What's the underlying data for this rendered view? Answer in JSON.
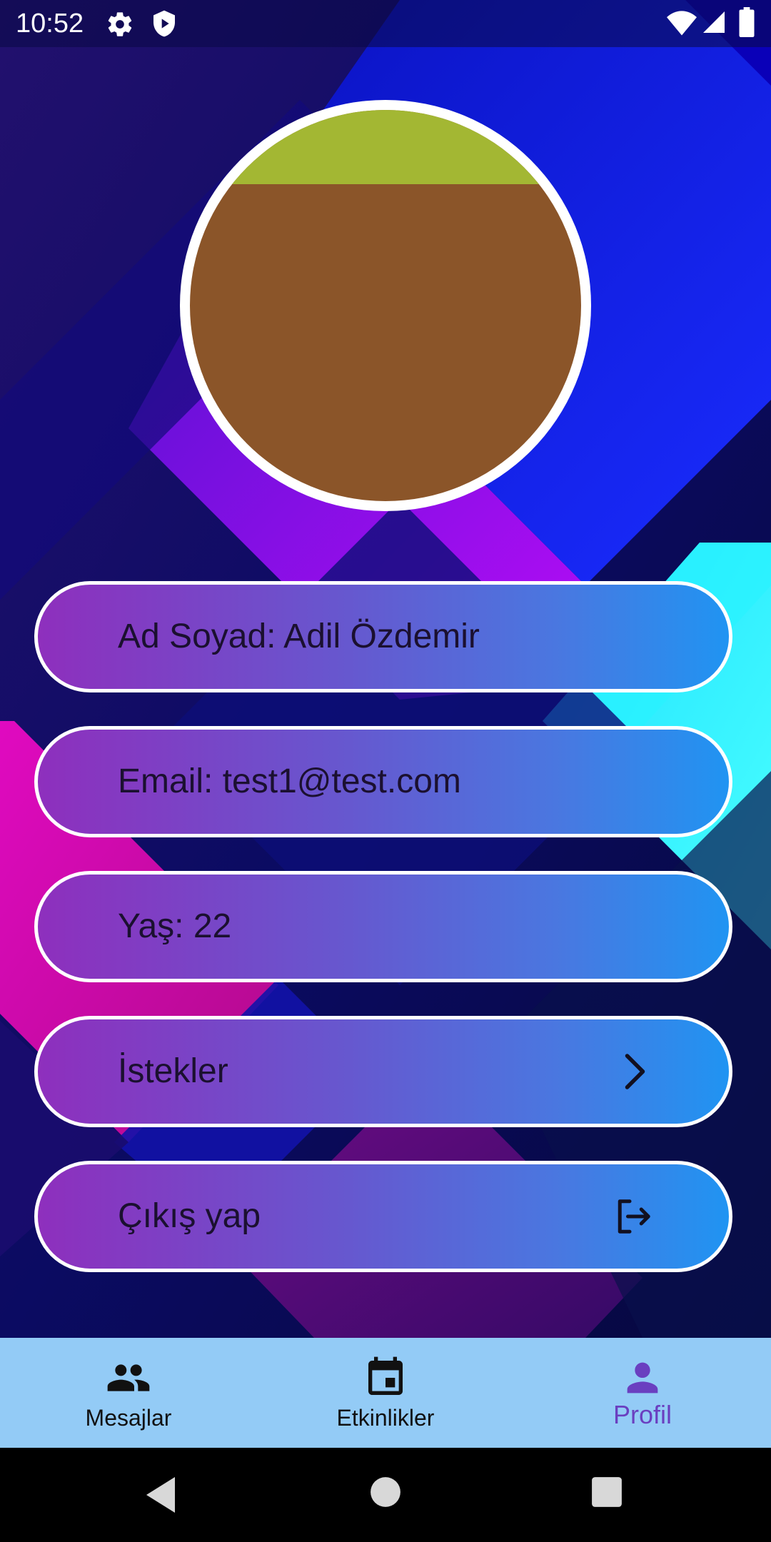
{
  "status_bar": {
    "time": "10:52",
    "icons": [
      "gear-icon",
      "shield-icon",
      "wifi-icon",
      "signal-icon",
      "battery-icon"
    ]
  },
  "profile": {
    "avatar": "profile-avatar"
  },
  "info": {
    "name_label": "Ad Soyad: Adil Özdemir",
    "email_label": "Email: test1@test.com",
    "age_label": "Yaş: 22"
  },
  "actions": {
    "requests_label": "İstekler",
    "requests_icon": "chevron-right-icon",
    "logout_label": "Çıkış yap",
    "logout_icon": "logout-icon"
  },
  "bottom_nav": {
    "items": [
      {
        "label": "Mesajlar",
        "icon": "people-icon",
        "active": false
      },
      {
        "label": "Etkinlikler",
        "icon": "calendar-icon",
        "active": false
      },
      {
        "label": "Profil",
        "icon": "person-icon",
        "active": true
      }
    ]
  },
  "system_nav": {
    "buttons": [
      "back-icon",
      "home-icon",
      "recents-icon"
    ]
  },
  "colors": {
    "pill_gradient_start": "#8e2fbd",
    "pill_gradient_end": "#2094f2",
    "nav_background": "#93cbf6",
    "nav_active": "#6a3fc0",
    "avatar_brown": "#8b5529",
    "avatar_green": "#a3b733"
  }
}
